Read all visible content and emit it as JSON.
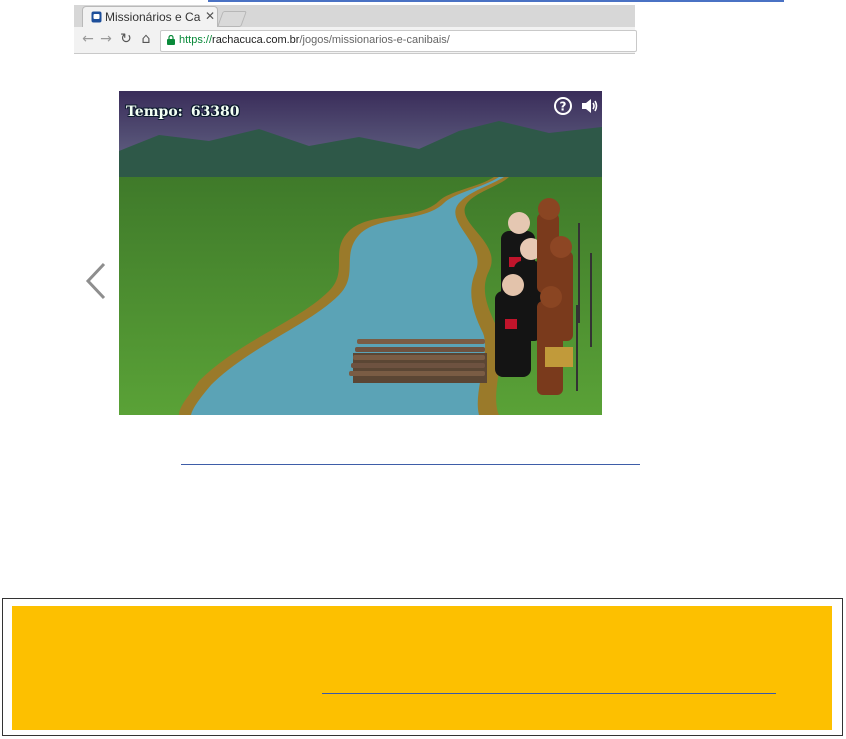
{
  "browser": {
    "tab_title": "Missionários e Canibais",
    "url_scheme": "https://",
    "url_host": "rachacuca.com.br",
    "url_path": "/jogos/missionarios-e-canibais/"
  },
  "game": {
    "timer_label": "Tempo:",
    "timer_value": "63380",
    "help_symbol": "?"
  },
  "colors": {
    "sky_top": "#3b2f5a",
    "mountains": "#2f5a4c",
    "grass": "#4c8f2e",
    "river": "#5aa6b8",
    "notice_fill": "#fdc000",
    "link_rule": "#3e5da8"
  }
}
